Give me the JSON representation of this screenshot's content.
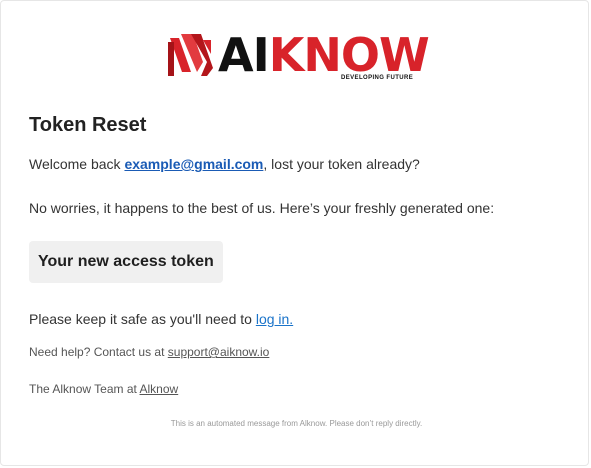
{
  "brand": {
    "logo_ai": "AI",
    "logo_know": "KNOW",
    "tagline": "DEVELOPING FUTURE",
    "color_red": "#d8232a",
    "color_dark": "#111111"
  },
  "email": {
    "title": "Token Reset",
    "welcome_prefix": "Welcome back ",
    "user_email": "example@gmail.com",
    "welcome_suffix": ", lost your token already?",
    "worries_text": "No worries, it happens to the best of us. Here’s your freshly generated one:",
    "token_label": "Your new access token",
    "keep_safe_prefix": "Please keep it safe as you'll need to ",
    "login_link": "log in.",
    "help_prefix": "Need help? Contact us at ",
    "support_email": "support@aiknow.io",
    "team_prefix": "The Alknow Team at ",
    "team_link": "Alknow",
    "footer_note": "This is an automated message from Alknow. Please don’t reply directly."
  },
  "colors": {
    "link_email": "#1a5bb5",
    "link_login": "#1a73c9",
    "token_bg": "#f0f0f0"
  }
}
